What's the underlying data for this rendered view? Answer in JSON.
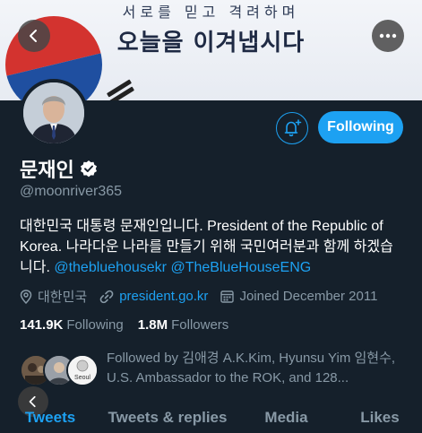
{
  "banner": {
    "line1": "서로를 믿고 격려하며",
    "line2": "오늘을 이겨냅시다"
  },
  "profile": {
    "name": "문재인",
    "handle": "@moonriver365",
    "bio_text": "대한민국 대통령 문재인입니다. President of the Republic of Korea. 나라다운 나라를 만들기 위해 국민여러분과 함께 하겠습니다. ",
    "bio_link1": "@thebluehousekr",
    "bio_link2": "@TheBlueHouseENG",
    "location": "대한민국",
    "website": "president.go.kr",
    "joined": "Joined December 2011",
    "following_count": "141.9K",
    "following_label": "Following",
    "followers_count": "1.8M",
    "followers_label": "Followers",
    "followed_by": "Followed by 김애경 A.K.Kim, Hyunsu Yim 임현수, U.S. Ambassador to the ROK, and 128...",
    "seoul_badge": "Seoul"
  },
  "actions": {
    "follow_label": "Following"
  },
  "tabs": [
    "Tweets",
    "Tweets & replies",
    "Media",
    "Likes"
  ],
  "colors": {
    "background": "#15202b",
    "accent": "#1da1f2",
    "secondary_text": "#8899a6"
  },
  "icons": [
    "back-arrow-icon",
    "more-icon",
    "bell-plus-icon",
    "verified-badge-icon",
    "location-pin-icon",
    "link-icon",
    "calendar-icon"
  ]
}
